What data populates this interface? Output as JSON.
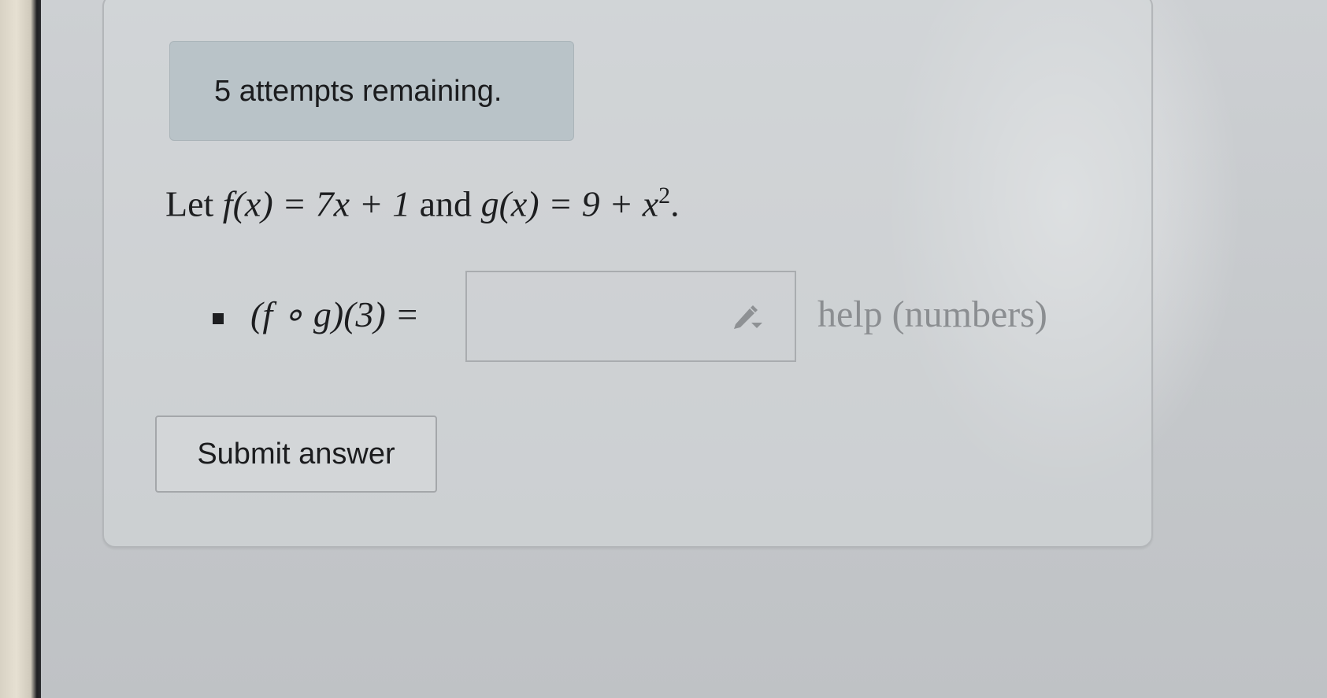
{
  "status": {
    "attempts_text": "5 attempts remaining."
  },
  "problem": {
    "lead": "Let ",
    "f_expr": "f(x) = 7x + 1",
    "joiner": " and ",
    "g_expr": "g(x) = 9 + x",
    "g_exponent": "2",
    "end": "."
  },
  "part": {
    "expression": "(f ∘ g)(3) =",
    "answer_value": "",
    "help_text": "help (numbers)"
  },
  "actions": {
    "submit_label": "Submit answer"
  },
  "icons": {
    "editor": "pencil-icon"
  }
}
